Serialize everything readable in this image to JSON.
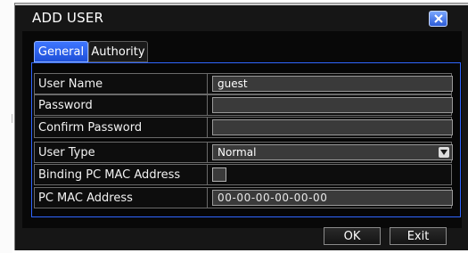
{
  "dialog": {
    "title": "ADD USER"
  },
  "tabs": [
    {
      "label": "General",
      "active": true
    },
    {
      "label": "Authority",
      "active": false
    }
  ],
  "form": {
    "rows": [
      {
        "label": "User Name",
        "value": "guest",
        "type": "text"
      },
      {
        "label": "Password",
        "value": "",
        "type": "password"
      },
      {
        "label": "Confirm Password",
        "value": "",
        "type": "password"
      },
      {
        "label": "User Type",
        "value": "Normal",
        "type": "select"
      },
      {
        "label": "Binding PC MAC Address",
        "checked": false,
        "type": "checkbox"
      },
      {
        "label": "PC MAC Address",
        "value": "00-00-00-00-00-00",
        "type": "text"
      }
    ]
  },
  "buttons": {
    "ok": "OK",
    "exit": "Exit"
  },
  "colors": {
    "accent": "#2f66ff",
    "background": "#161616"
  }
}
